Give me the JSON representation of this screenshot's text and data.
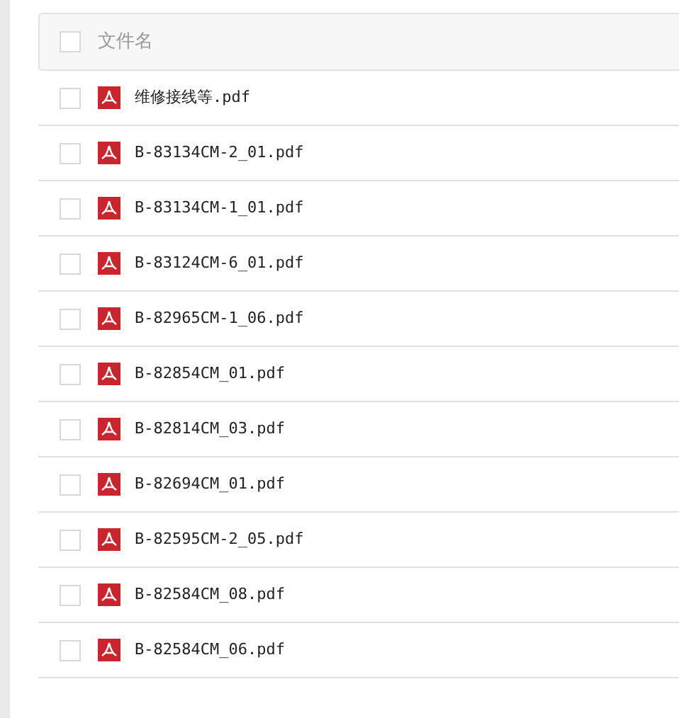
{
  "header": {
    "label": "文件名",
    "checked": false
  },
  "files": [
    {
      "name": "维修接线等.pdf",
      "checked": false
    },
    {
      "name": "B-83134CM-2_01.pdf",
      "checked": false
    },
    {
      "name": "B-83134CM-1_01.pdf",
      "checked": false
    },
    {
      "name": "B-83124CM-6_01.pdf",
      "checked": false
    },
    {
      "name": "B-82965CM-1_06.pdf",
      "checked": false
    },
    {
      "name": "B-82854CM_01.pdf",
      "checked": false
    },
    {
      "name": "B-82814CM_03.pdf",
      "checked": false
    },
    {
      "name": "B-82694CM_01.pdf",
      "checked": false
    },
    {
      "name": "B-82595CM-2_05.pdf",
      "checked": false
    },
    {
      "name": "B-82584CM_08.pdf",
      "checked": false
    },
    {
      "name": "B-82584CM_06.pdf",
      "checked": false
    }
  ]
}
